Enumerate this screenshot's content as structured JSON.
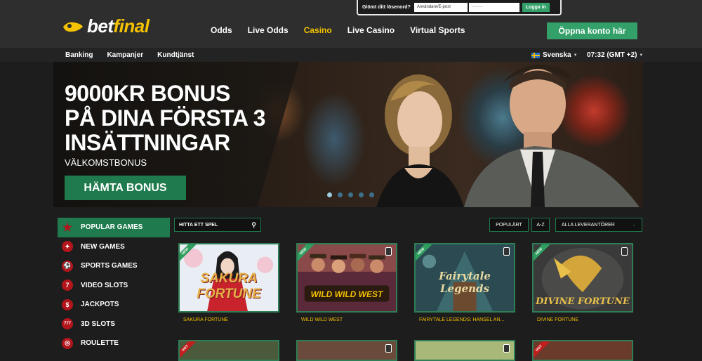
{
  "brand": {
    "name_main": "bet",
    "name_accent": "final"
  },
  "nav": [
    {
      "label": "Odds",
      "active": false
    },
    {
      "label": "Live Odds",
      "active": false
    },
    {
      "label": "Casino",
      "active": true
    },
    {
      "label": "Live Casino",
      "active": false
    },
    {
      "label": "Virtual Sports",
      "active": false
    }
  ],
  "login": {
    "forgot": "Glömt ditt lösenord?",
    "user_placeholder": "Användare/E-post",
    "password_mask": "········",
    "button": "Logga in"
  },
  "open_account": "Öppna konto här",
  "subnav": [
    "Banking",
    "Kampanjer",
    "Kundtjänst"
  ],
  "language": "Svenska",
  "clock": "07:32 (GMT +2)",
  "hero": {
    "title_lines": [
      "9000KR BONUS",
      "PÅ DINA FÖRSTA 3",
      "INSÄTTNINGAR"
    ],
    "subtitle": "VÄLKOMSTBONUS",
    "button": "HÄMTA BONUS",
    "slides": 5,
    "active_slide": 0
  },
  "sidebar": [
    {
      "label": "POPULAR GAMES",
      "icon": "star-icon",
      "glyph": "★",
      "active": true
    },
    {
      "label": "NEW GAMES",
      "icon": "megaphone-icon",
      "glyph": "✦",
      "active": false
    },
    {
      "label": "SPORTS GAMES",
      "icon": "football-icon",
      "glyph": "⚽",
      "active": false
    },
    {
      "label": "VIDEO SLOTS",
      "icon": "seven-icon",
      "glyph": "7",
      "active": false
    },
    {
      "label": "JACKPOTS",
      "icon": "dollar-icon",
      "glyph": "$",
      "active": false
    },
    {
      "label": "3D SLOTS",
      "icon": "slot-777-icon",
      "glyph": "777",
      "active": false
    },
    {
      "label": "ROULETTE",
      "icon": "roulette-icon",
      "glyph": "◎",
      "active": false
    }
  ],
  "search": {
    "placeholder": "HITTA ETT SPEL"
  },
  "sort": {
    "popular": "POPULÄRT",
    "az": "A-Z",
    "providers": "ALLA LEVERANTÖRER"
  },
  "games": [
    {
      "name": "SAKURA FORTUNE",
      "badge": "NEW",
      "logo": "SAKURA FORTUNE"
    },
    {
      "name": "WILD WILD WEST",
      "badge": "NEW",
      "logo": "WILD WILD WEST"
    },
    {
      "name": "FAIRYTALE LEGENDS: HANSEL AN...",
      "badge": "NEW",
      "logo": "Fairytale Legends"
    },
    {
      "name": "DIVINE FORTUNE",
      "badge": "NEW",
      "logo": "DIVINE FORTUNE"
    }
  ],
  "games_row2_badges": [
    "HOT",
    "",
    "",
    "HOT"
  ],
  "colors": {
    "accent_yellow": "#f4c200",
    "green": "#1f7a4d",
    "button_green": "#33a06a",
    "red_icon": "#b3151c"
  }
}
